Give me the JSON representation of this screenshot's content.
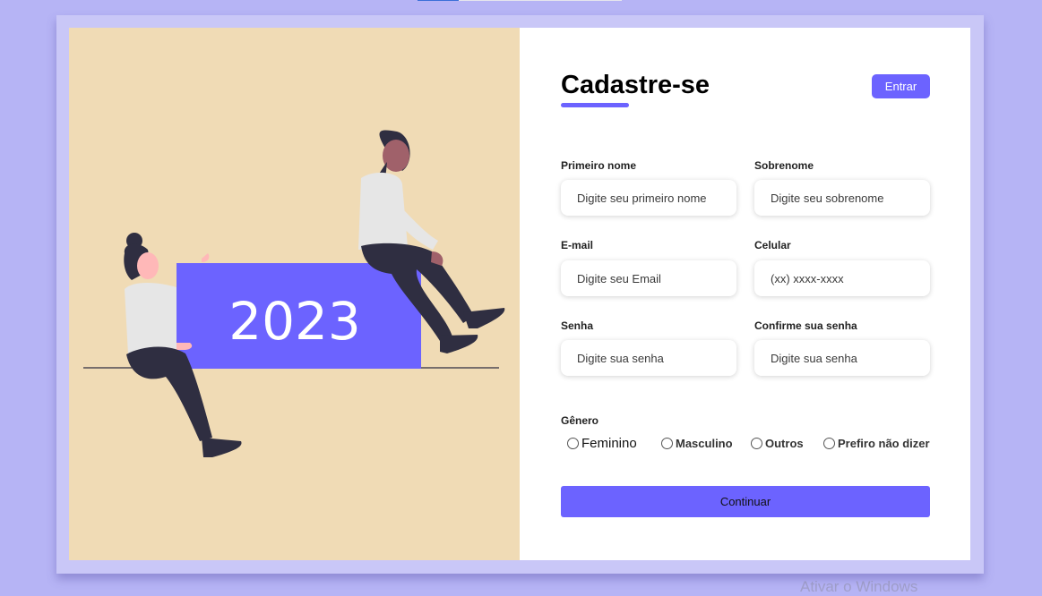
{
  "form": {
    "title": "Cadastre-se",
    "login_button": "Entrar",
    "fields": {
      "first_name": {
        "label": "Primeiro nome",
        "placeholder": "Digite seu primeiro nome"
      },
      "last_name": {
        "label": "Sobrenome",
        "placeholder": "Digite seu sobrenome"
      },
      "email": {
        "label": "E-mail",
        "placeholder": "Digite seu Email"
      },
      "phone": {
        "label": "Celular",
        "placeholder": "(xx) xxxx-xxxx"
      },
      "password": {
        "label": "Senha",
        "placeholder": "Digite sua senha"
      },
      "confirm_password": {
        "label": "Confirme sua senha",
        "placeholder": "Digite sua senha"
      }
    },
    "gender": {
      "label": "Gênero",
      "options": [
        "Feminino",
        "Masculino",
        "Outros",
        "Prefiro não dizer"
      ]
    },
    "continue_button": "Continuar"
  },
  "illustration": {
    "year_text": "2023"
  },
  "watermark": "Ativar o Windows",
  "colors": {
    "accent": "#6c63ff",
    "background": "#b6b4f5",
    "panel_left": "#f0dbb5"
  }
}
